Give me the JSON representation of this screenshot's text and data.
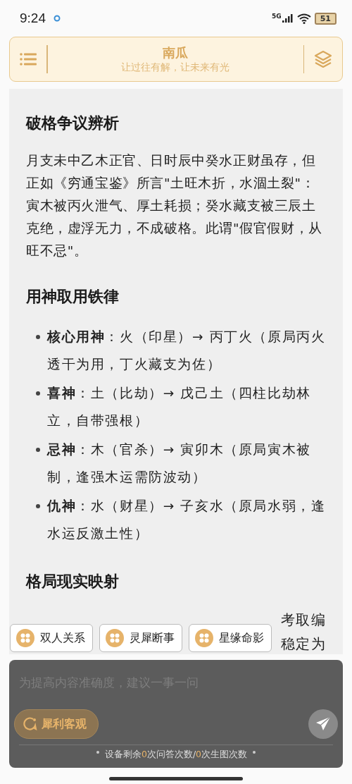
{
  "status_bar": {
    "time": "9:24",
    "network": "5G",
    "battery": "51"
  },
  "header": {
    "title": "南瓜",
    "subtitle": "让过往有解，让未来有光"
  },
  "sections": [
    {
      "heading": "破格争议辨析",
      "paragraph": "月支未中乙木正官、日时辰中癸水正财虽存，但正如《穷通宝鉴》所言\"土旺木折，水涸土裂\"：寅木被丙火泄气、厚土耗损；癸水藏支被三辰土克绝，虚浮无力，不成破格。此谓\"假官假财，从旺不忌\"。"
    },
    {
      "heading": "用神取用铁律",
      "bullets": [
        "**核心用神**：火（印星）→ 丙丁火（原局丙火透干为用，丁火藏支为佐）",
        "**喜神**：土（比劫）→ 戊己土（四柱比劫林立，自带强根）",
        "**忌神**：木（官杀）→ 寅卯木（原局寅木被制，逢强木运需防波动）",
        "**仇神**：水（财星）→ 子亥水（原局水弱，逢水运反激土性）"
      ]
    },
    {
      "heading": "格局现实映射",
      "fragments": [
        "考取编",
        "稳定为"
      ]
    }
  ],
  "quick_chips": [
    "双人关系",
    "灵犀断事",
    "星缘命影"
  ],
  "input": {
    "placeholder": "为提高内容准确度，建议一事一问"
  },
  "mode_button": "犀利客观",
  "quota": [
    {
      "kind": "text",
      "text": "设备剩余"
    },
    {
      "kind": "count",
      "text": "0"
    },
    {
      "kind": "text",
      "text": "次问答次数/"
    },
    {
      "kind": "count",
      "text": "0"
    },
    {
      "kind": "text",
      "text": "次生图次数"
    }
  ]
}
